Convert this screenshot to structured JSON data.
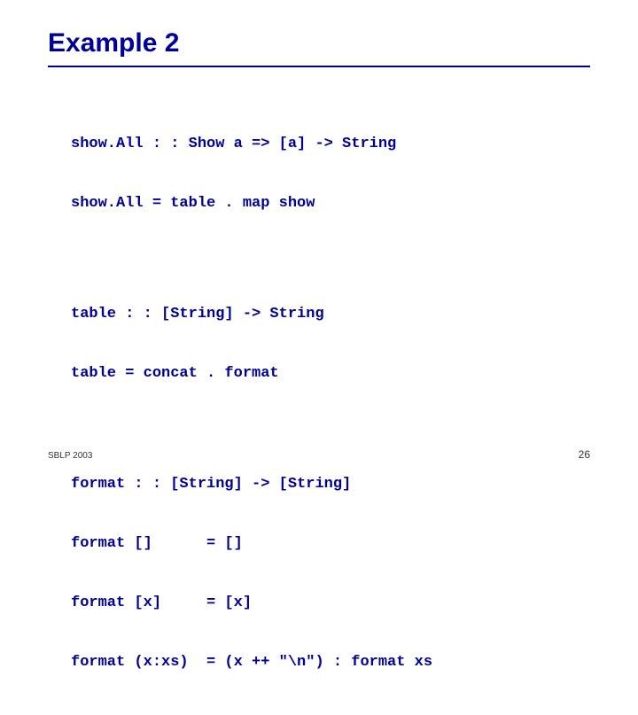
{
  "title": "Example 2",
  "code": {
    "l1": "show.All : : Show a => [a] -> String",
    "l2": "show.All = table . map show",
    "l3": "table : : [String] -> String",
    "l4": "table = concat . format",
    "l5": "format : : [String] -> [String]",
    "l6": "format []      = []",
    "l7": "format [x]     = [x]",
    "l8": "format (x:xs)  = (x ++ \"\\n\") : format xs"
  },
  "footer": {
    "left": "SBLP 2003",
    "right": "26"
  }
}
